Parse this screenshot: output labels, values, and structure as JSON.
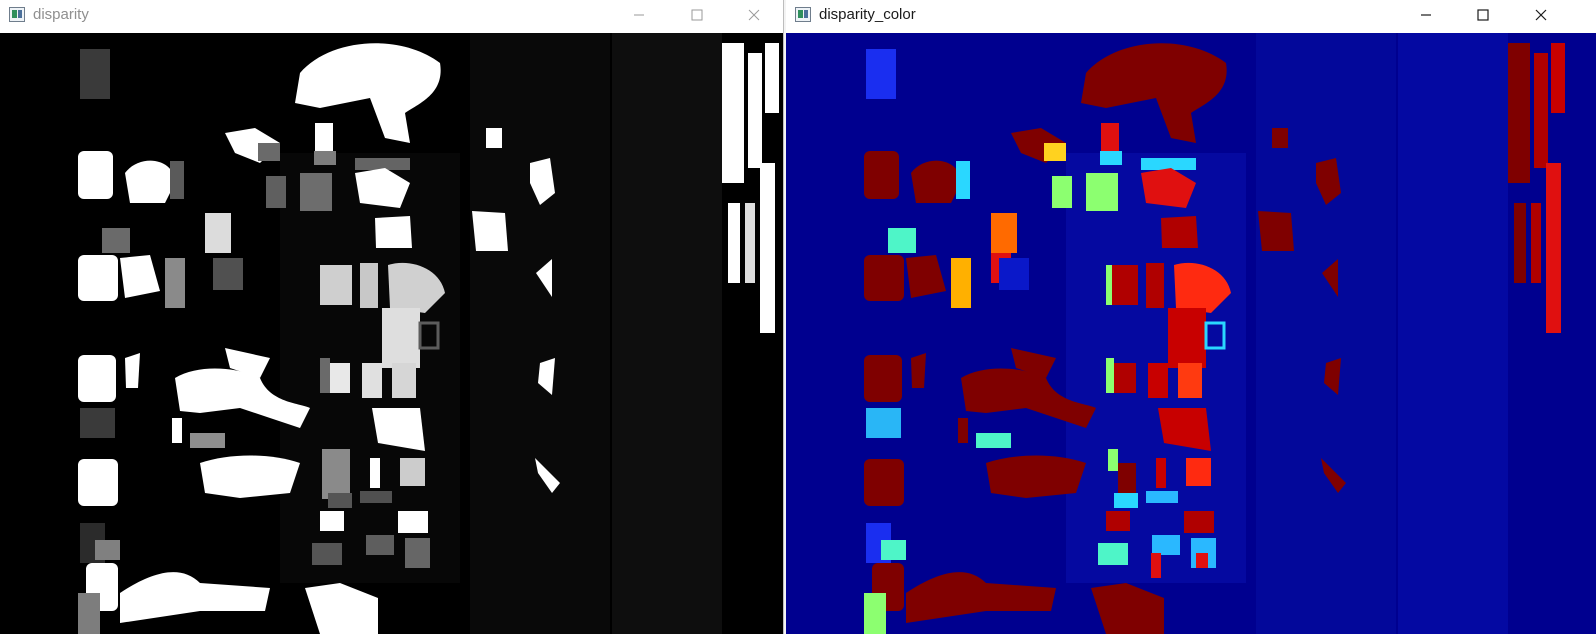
{
  "windows": [
    {
      "id": "disparity",
      "title": "disparity",
      "state": "inactive",
      "background_color": "#000000",
      "controls": [
        "minimize-icon",
        "maximize-icon",
        "close-icon"
      ]
    },
    {
      "id": "disparity_color",
      "title": "disparity_color",
      "state": "active",
      "background_color": "#00008f",
      "controls": [
        "minimize-icon",
        "maximize-icon",
        "close-icon"
      ]
    }
  ],
  "colors": {
    "titlebar": "#ffffff",
    "inactive_title_text": "#8f8f8f",
    "active_title_text": "#1b1b1b",
    "jet_dark_red": "#7f0000",
    "jet_red": "#e01010",
    "jet_orange": "#ff8a00",
    "jet_yellow": "#ffd21f",
    "jet_green": "#8cff70",
    "jet_cyan": "#2ad7ff",
    "jet_blue": "#0a18c9",
    "jet_navy": "#00008f"
  }
}
